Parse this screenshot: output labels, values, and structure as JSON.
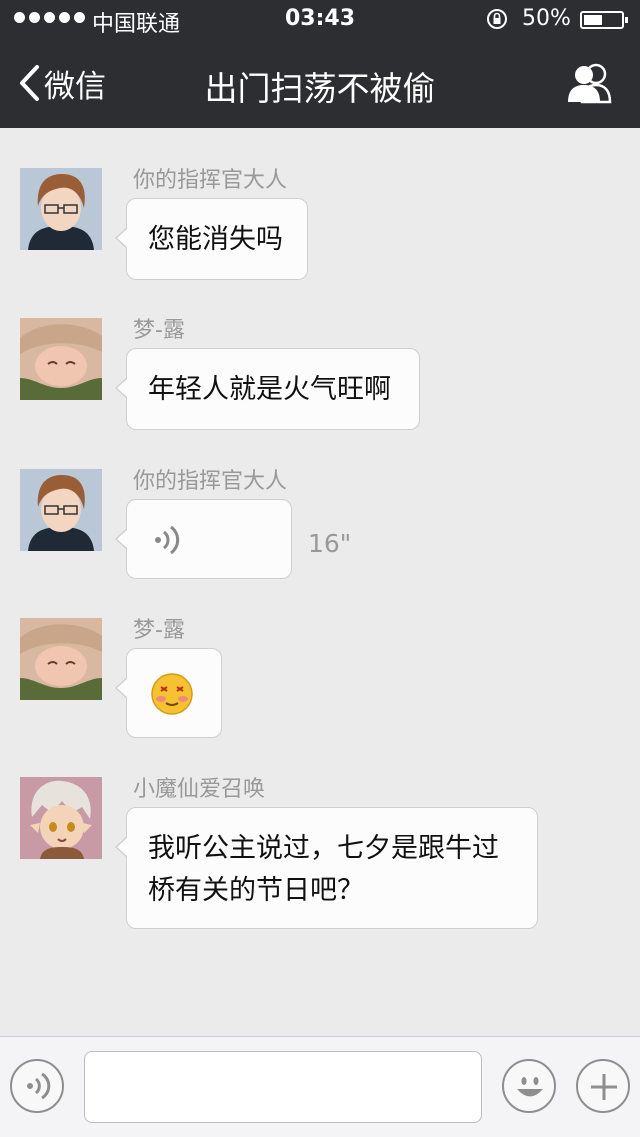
{
  "status": {
    "carrier": "中国联通",
    "time": "03:43",
    "battery_pct": "50%",
    "battery_level": 0.5
  },
  "nav": {
    "back_label": "微信",
    "title": "出门扫荡不被偷"
  },
  "messages": [
    {
      "sender": "你的指挥官大人",
      "text": "您能消失吗"
    },
    {
      "sender": "梦-露",
      "text": "年轻人就是火气旺啊"
    },
    {
      "sender": "你的指挥官大人",
      "type": "voice",
      "duration": "16\""
    },
    {
      "sender": "梦-露",
      "type": "emoji",
      "emoji": "😳"
    },
    {
      "sender": "小魔仙爱召唤",
      "text": "我听公主说过，七夕是跟牛过桥有关的节日吧？"
    }
  ],
  "input": {
    "value": "",
    "placeholder": ""
  },
  "icons": {
    "voice": "voice-toggle-icon",
    "emoji": "emoji-icon",
    "more": "plus-icon"
  },
  "colors": {
    "header_bg": "#2d2e32",
    "chat_bg": "#ebebeb",
    "bubble_bg": "#fcfcfc"
  }
}
